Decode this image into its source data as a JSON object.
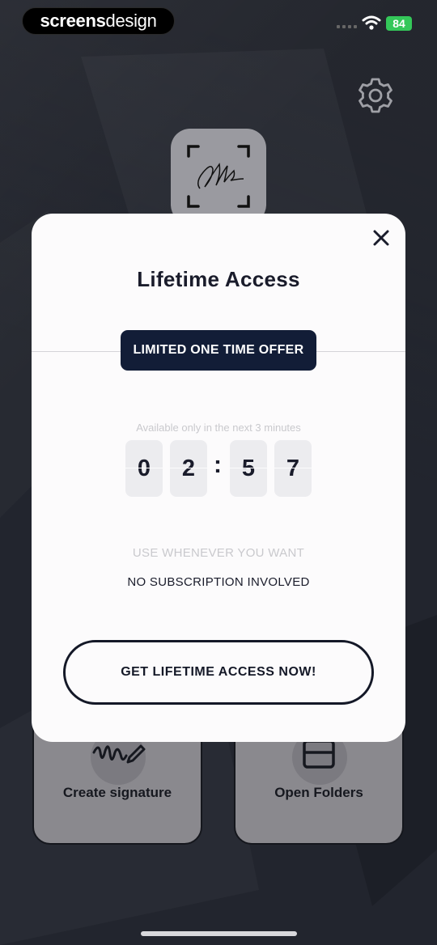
{
  "status_bar": {
    "brand_bold": "screens",
    "brand_light": "design",
    "battery": "84"
  },
  "icons": {
    "settings": "gear-icon",
    "close": "close-icon",
    "signature": "signature-icon",
    "folder": "folder-icon",
    "wifi": "wifi-icon"
  },
  "tiles": {
    "create_signature": "Create signature",
    "open_folders": "Open Folders"
  },
  "modal": {
    "title": "Lifetime Access",
    "offer_badge": "LIMITED ONE TIME OFFER",
    "availability": "Available only in the next 3 minutes",
    "timer": {
      "d1": "0",
      "d2": "2",
      "separator": ":",
      "d3": "5",
      "d4": "7"
    },
    "use_text": "USE WHENEVER YOU WANT",
    "no_subscription": "NO SUBSCRIPTION INVOLVED",
    "cta_label": "GET LIFETIME ACCESS NOW!"
  },
  "colors": {
    "background": "#1b1e27",
    "modal": "#fcfbfc",
    "badge": "#121d37",
    "battery": "#34c759"
  }
}
